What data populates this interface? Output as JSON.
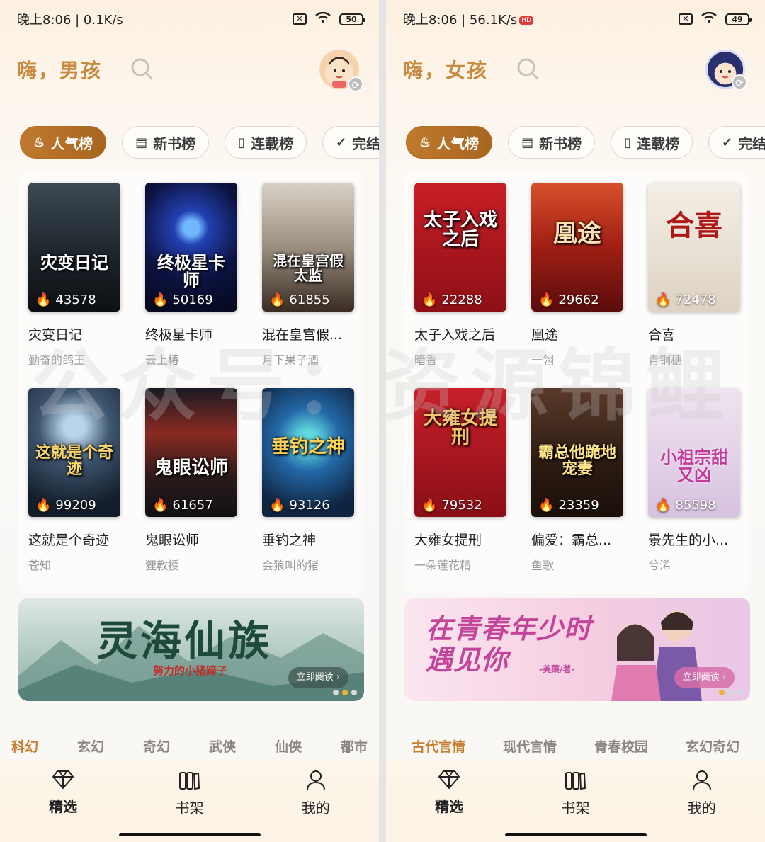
{
  "left": {
    "status": {
      "time_speed": "晚上8:06 | 0.1K/s",
      "battery": "50"
    },
    "greeting": "嗨，男孩",
    "tabs": [
      {
        "label": "人气榜"
      },
      {
        "label": "新书榜"
      },
      {
        "label": "连载榜"
      },
      {
        "label": "完结榜"
      }
    ],
    "books": [
      {
        "title": "灾变日记",
        "author": "勤奋的鸽王",
        "heat": "43578",
        "cover_text": "灾变日记",
        "bg": "#1f2a33"
      },
      {
        "title": "终极星卡师",
        "author": "云上椿",
        "heat": "50169",
        "cover_text": "终极星卡师",
        "bg": "#101a4a"
      },
      {
        "title": "混在皇宫假...",
        "author": "月下果子酒",
        "heat": "61855",
        "cover_text": "混在皇宫假太监",
        "bg": "#b8b0a4"
      },
      {
        "title": "这就是个奇迹",
        "author": "苍知",
        "heat": "99209",
        "cover_text": "这就是个奇迹",
        "bg": "#1b2a3a"
      },
      {
        "title": "鬼眼讼师",
        "author": "狸教授",
        "heat": "61657",
        "cover_text": "鬼眼讼师",
        "bg": "#3a2020"
      },
      {
        "title": "垂钓之神",
        "author": "会狼叫的猪",
        "heat": "93126",
        "cover_text": "垂钓之神",
        "bg": "#1a3a5c"
      }
    ],
    "banner": {
      "title": "灵海仙族",
      "subtitle": "努力的小猪蹄子",
      "read": "立即阅读 ›"
    },
    "categories": [
      "科幻",
      "玄幻",
      "奇幻",
      "武侠",
      "仙侠",
      "都市"
    ]
  },
  "right": {
    "status": {
      "time_speed": "晚上8:06 | 56.1K/s",
      "battery": "49"
    },
    "greeting": "嗨，女孩",
    "tabs": [
      {
        "label": "人气榜"
      },
      {
        "label": "新书榜"
      },
      {
        "label": "连载榜"
      },
      {
        "label": "完结榜"
      }
    ],
    "books": [
      {
        "title": "太子入戏之后",
        "author": "暗香",
        "heat": "22288",
        "cover_text": "太子入戏之后",
        "bg": "#a8141c"
      },
      {
        "title": "凰途",
        "author": "一翎",
        "heat": "29662",
        "cover_text": "凰途",
        "bg": "#9a1e18"
      },
      {
        "title": "合喜",
        "author": "青铜穗",
        "heat": "72478",
        "cover_text": "合喜",
        "bg": "#ece6dc"
      },
      {
        "title": "大雍女提刑",
        "author": "一朵莲花精",
        "heat": "79532",
        "cover_text": "大雍女提刑",
        "bg": "#b01820"
      },
      {
        "title": "偏爱：霸总...",
        "author": "鱼歌",
        "heat": "23359",
        "cover_text": "霸总他跪地宠妻",
        "bg": "#2a1c16"
      },
      {
        "title": "景先生的小...",
        "author": "兮浠",
        "heat": "85598",
        "cover_text": "小祖宗甜又凶",
        "bg": "#e6d8ea"
      }
    ],
    "banner": {
      "title": "在青春年少时遇见你",
      "subtitle": "-芙蕖/著-",
      "read": "立即阅读 ›"
    },
    "categories": [
      "古代言情",
      "现代言情",
      "青春校园",
      "玄幻奇幻"
    ]
  },
  "nav": [
    {
      "label": "精选"
    },
    {
      "label": "书架"
    },
    {
      "label": "我的"
    }
  ],
  "watermark": "公众号：资源锦鲤"
}
